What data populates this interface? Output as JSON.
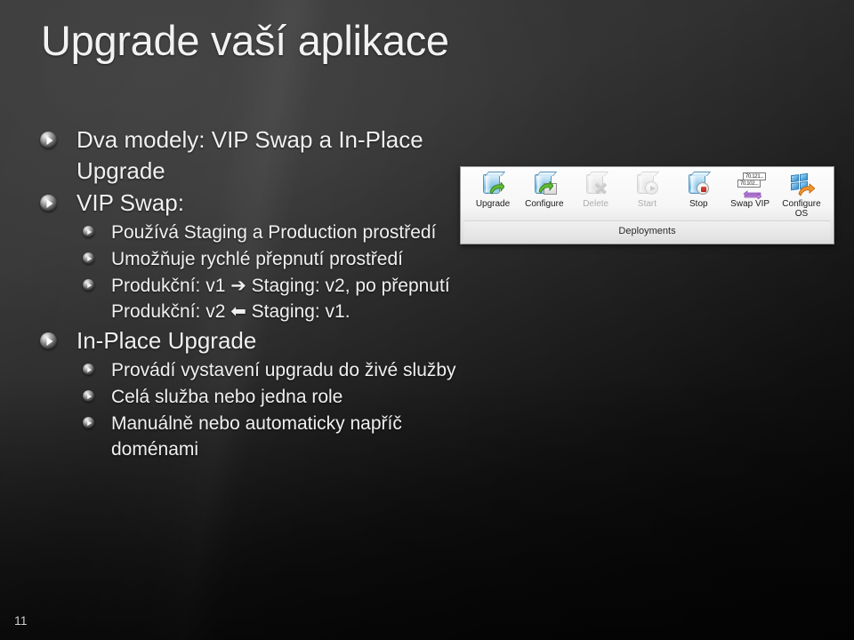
{
  "slide": {
    "title": "Upgrade vaší aplikace",
    "number": "11"
  },
  "outline": [
    {
      "level": 1,
      "text": "Dva modely:  VIP Swap a In-Place Upgrade"
    },
    {
      "level": 1,
      "text": "VIP Swap:"
    },
    {
      "level": 2,
      "text": "Používá Staging a Production prostředí"
    },
    {
      "level": 2,
      "text": "Umožňuje rychlé přepnutí prostředí"
    },
    {
      "level": 2,
      "text": "Produkční: v1 ➔ Staging: v2, po přepnutí Produkční: v2 ⬅ Staging: v1."
    },
    {
      "level": 1,
      "text": "In-Place Upgrade"
    },
    {
      "level": 2,
      "text": "Provádí vystavení upgradu do živé služby"
    },
    {
      "level": 2,
      "text": "Celá služba nebo jedna role"
    },
    {
      "level": 2,
      "text": "Manuálně nebo automaticky napříč doménami"
    }
  ],
  "screenshot": {
    "group_label": "Deployments",
    "buttons": [
      {
        "label": "Upgrade",
        "icon": "upgrade-box-icon",
        "enabled": true
      },
      {
        "label": "Configure",
        "icon": "configure-box-icon",
        "enabled": true
      },
      {
        "label": "Delete",
        "icon": "delete-box-icon",
        "enabled": false
      },
      {
        "label": "Start",
        "icon": "start-box-icon",
        "enabled": false
      },
      {
        "label": "Stop",
        "icon": "stop-box-icon",
        "enabled": true
      },
      {
        "label": "Swap\nVIP",
        "icon": "swap-vip-icon",
        "enabled": true
      },
      {
        "label": "Configure\nOS",
        "icon": "configure-os-icon",
        "enabled": true
      }
    ],
    "swap_vip_ips": {
      "top": "70.121...",
      "bottom": "70.102..."
    }
  },
  "colors": {
    "background_top": "#373737",
    "background_bottom": "#0b0b0b",
    "text": "#f0f0f0",
    "accent_green": "#4ea72e",
    "accent_red": "#c42b1c",
    "accent_purple": "#a96fd0",
    "accent_orange": "#e8852a",
    "accent_blue": "#2f8ccd"
  }
}
